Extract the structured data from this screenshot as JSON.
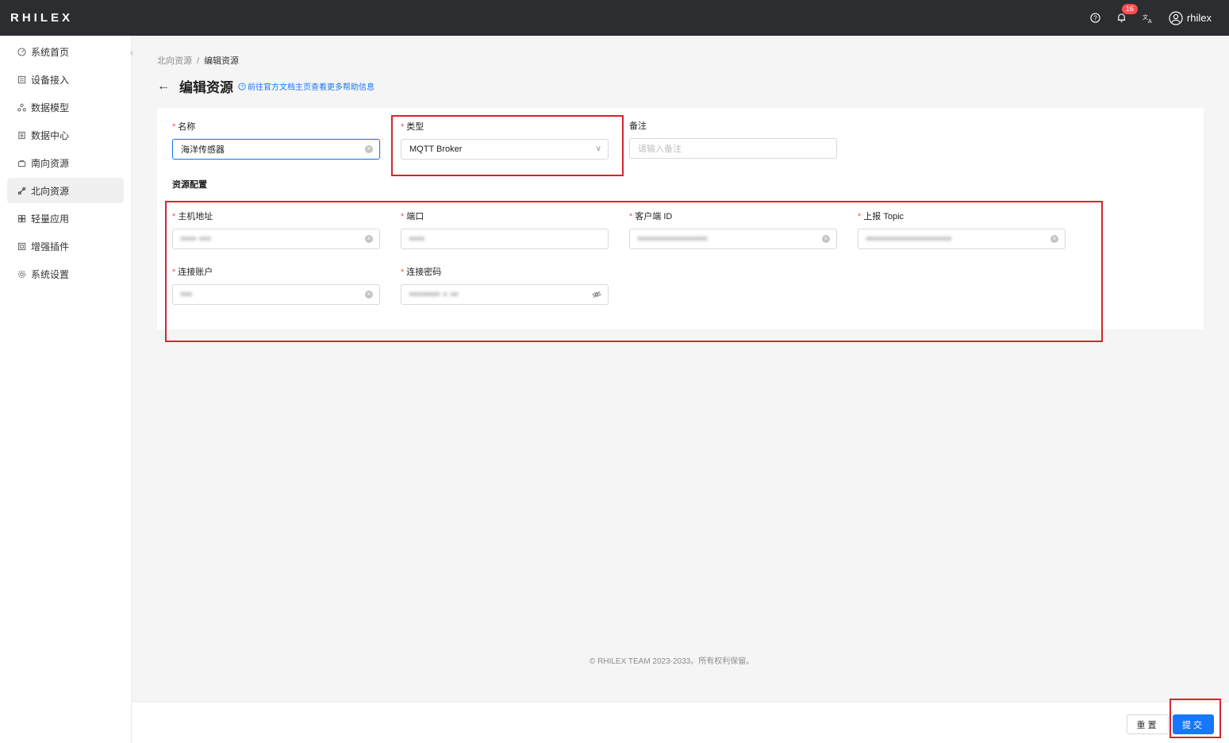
{
  "header": {
    "logo": "RHILEX",
    "notification_count": "16",
    "username": "rhilex"
  },
  "sidebar": {
    "items": [
      {
        "label": "系统首页",
        "icon": "dashboard-icon"
      },
      {
        "label": "设备接入",
        "icon": "device-icon"
      },
      {
        "label": "数据模型",
        "icon": "model-icon"
      },
      {
        "label": "数据中心",
        "icon": "data-center-icon"
      },
      {
        "label": "南向资源",
        "icon": "south-resource-icon"
      },
      {
        "label": "北向资源",
        "icon": "north-resource-icon",
        "active": true
      },
      {
        "label": "轻量应用",
        "icon": "apps-icon"
      },
      {
        "label": "增强插件",
        "icon": "plugin-icon"
      },
      {
        "label": "系统设置",
        "icon": "settings-icon"
      }
    ]
  },
  "breadcrumb": {
    "parent": "北向资源",
    "separator": "/",
    "current": "编辑资源"
  },
  "page": {
    "title": "编辑资源",
    "doc_link": "前往官方文档主页查看更多帮助信息"
  },
  "form": {
    "name": {
      "label": "名称",
      "value": "海洋传感器"
    },
    "type": {
      "label": "类型",
      "value": "MQTT Broker"
    },
    "remark": {
      "label": "备注",
      "placeholder": "请输入备注"
    },
    "section_title": "资源配置",
    "host": {
      "label": "主机地址",
      "value": "redacted"
    },
    "port": {
      "label": "端口",
      "value": "redacted"
    },
    "client_id": {
      "label": "客户端 ID",
      "value": "redacted"
    },
    "topic": {
      "label": "上报 Topic",
      "value": "redacted"
    },
    "username": {
      "label": "连接账户",
      "value": "redacted"
    },
    "password": {
      "label": "连接密码",
      "value": "redacted"
    }
  },
  "footer": {
    "copyright": "© RHILEX TEAM 2023-2033。所有权利保留。"
  },
  "actions": {
    "reset": "重置",
    "submit": "提交"
  }
}
